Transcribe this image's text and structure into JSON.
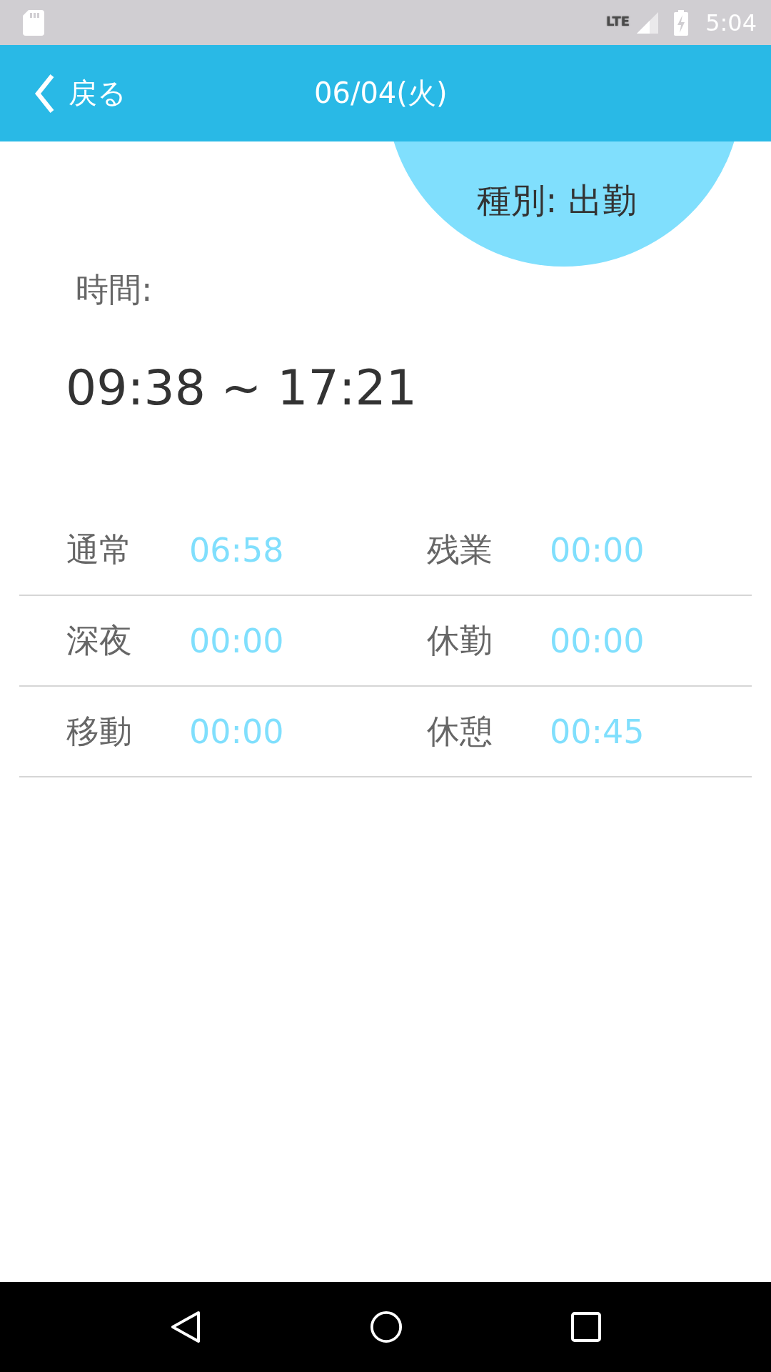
{
  "status_bar": {
    "network": "LTE",
    "time": "5:04"
  },
  "header": {
    "back": "戻る",
    "title": "06/04(火)"
  },
  "type_badge": "種別: 出勤",
  "time_label": "時間:",
  "time_range": "09:38 ~ 17:21",
  "rows": [
    {
      "cells": [
        {
          "label": "通常",
          "value": "06:58"
        },
        {
          "label": "残業",
          "value": "00:00"
        }
      ]
    },
    {
      "cells": [
        {
          "label": "深夜",
          "value": "00:00"
        },
        {
          "label": "休勤",
          "value": "00:00"
        }
      ]
    },
    {
      "cells": [
        {
          "label": "移動",
          "value": "00:00"
        },
        {
          "label": "休憩",
          "value": "00:45"
        }
      ]
    }
  ]
}
